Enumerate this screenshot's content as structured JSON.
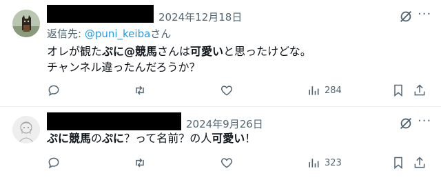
{
  "tweets": [
    {
      "date": "2024年12月18日",
      "reply_prefix": "返信先: ",
      "reply_handle": "@puni_keiba",
      "reply_suffix": "さん",
      "text_runs": [
        {
          "t": "オレが観た",
          "b": false
        },
        {
          "t": "ぷに@競馬",
          "b": true
        },
        {
          "t": "さんは",
          "b": false
        },
        {
          "t": "可愛い",
          "b": true
        },
        {
          "t": "と思ったけどな。",
          "b": false
        }
      ],
      "text_line2": "チャンネル違ったんだろうか？",
      "views": "284"
    },
    {
      "date": "2024年9月26日",
      "text_runs": [
        {
          "t": "ぷに競馬",
          "b": true
        },
        {
          "t": "の",
          "b": false
        },
        {
          "t": "ぷに",
          "b": true
        },
        {
          "t": "？って名前？の人",
          "b": false
        },
        {
          "t": "可愛い",
          "b": true
        },
        {
          "t": "！",
          "b": false
        }
      ],
      "views": "323"
    }
  ],
  "icons": [
    "avatar-dog",
    "avatar-sketch",
    "grok-icon",
    "more-icon",
    "reply-icon",
    "retweet-icon",
    "like-icon",
    "views-icon",
    "bookmark-icon",
    "share-icon"
  ],
  "colors": {
    "muted": "#536471",
    "link": "#1d9bf0",
    "divider": "#eff3f4",
    "text": "#0f1419"
  }
}
